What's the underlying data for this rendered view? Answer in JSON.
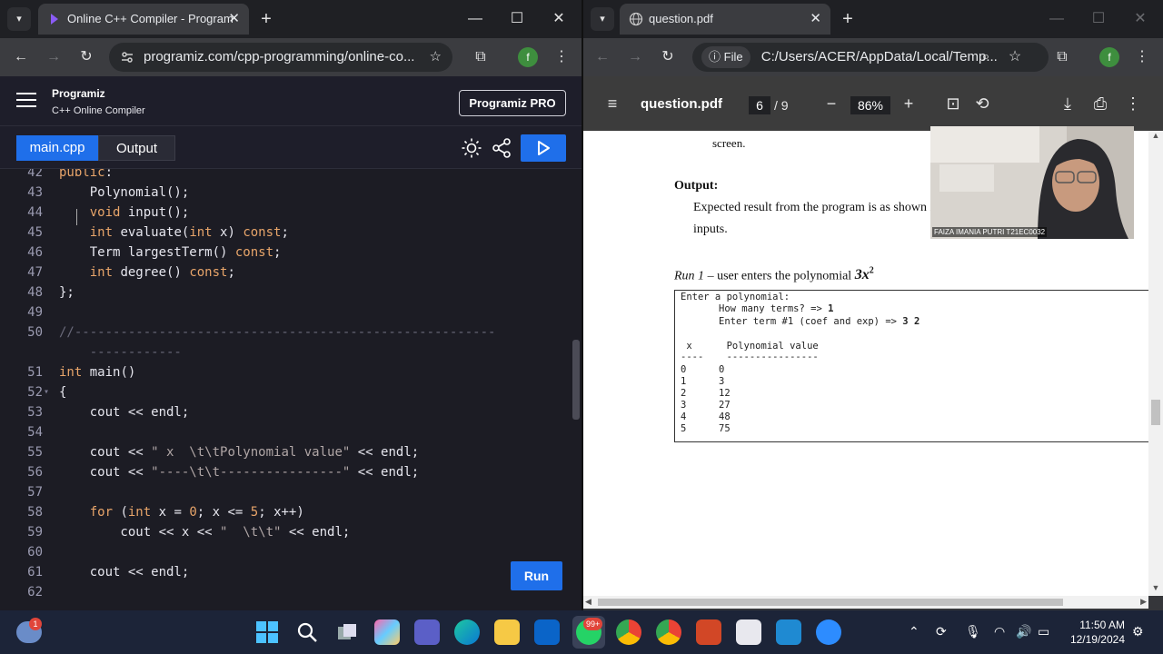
{
  "left_browser": {
    "tab_title": "Online C++ Compiler - Program",
    "url": "programiz.com/cpp-programming/online-co...",
    "profile_initial": "f"
  },
  "right_browser": {
    "tab_title": "question.pdf",
    "url_scheme": "File",
    "url": "C:/Users/ACER/AppData/Local/Temp...",
    "profile_initial": "f"
  },
  "programiz": {
    "logo": "Programiz",
    "title": "C++ Online Compiler",
    "pro_button": "Programiz PRO",
    "file_tab": "main.cpp",
    "output_tab": "Output",
    "run_button": "Run"
  },
  "code": [
    {
      "n": "42",
      "fold": "",
      "segs": [
        [
          "kw",
          "public"
        ],
        [
          "t",
          ":"
        ]
      ]
    },
    {
      "n": "43",
      "fold": "",
      "segs": [
        [
          "t",
          "    Polynomial();"
        ]
      ]
    },
    {
      "n": "44",
      "fold": "",
      "segs": [
        [
          "t",
          "    "
        ],
        [
          "kw",
          "void"
        ],
        [
          "t",
          " input();"
        ]
      ]
    },
    {
      "n": "45",
      "fold": "",
      "segs": [
        [
          "t",
          "    "
        ],
        [
          "kw",
          "int"
        ],
        [
          "t",
          " evaluate("
        ],
        [
          "kw",
          "int"
        ],
        [
          "t",
          " x) "
        ],
        [
          "kw",
          "const"
        ],
        [
          "t",
          ";"
        ]
      ]
    },
    {
      "n": "46",
      "fold": "",
      "segs": [
        [
          "t",
          "    Term largestTerm() "
        ],
        [
          "kw",
          "const"
        ],
        [
          "t",
          ";"
        ]
      ]
    },
    {
      "n": "47",
      "fold": "",
      "segs": [
        [
          "t",
          "    "
        ],
        [
          "kw",
          "int"
        ],
        [
          "t",
          " degree() "
        ],
        [
          "kw",
          "const"
        ],
        [
          "t",
          ";"
        ]
      ]
    },
    {
      "n": "48",
      "fold": "",
      "segs": [
        [
          "t",
          "};"
        ]
      ]
    },
    {
      "n": "49",
      "fold": "",
      "segs": []
    },
    {
      "n": "50",
      "fold": "",
      "segs": [
        [
          "cm",
          "//-------------------------------------------------------"
        ]
      ]
    },
    {
      "n": "",
      "fold": "",
      "segs": [
        [
          "cm",
          "    ------------"
        ]
      ]
    },
    {
      "n": "51",
      "fold": "",
      "segs": [
        [
          "kw",
          "int"
        ],
        [
          "t",
          " main()"
        ]
      ]
    },
    {
      "n": "52",
      "fold": "▾",
      "segs": [
        [
          "t",
          "{"
        ]
      ]
    },
    {
      "n": "53",
      "fold": "",
      "segs": [
        [
          "t",
          "    cout << endl;"
        ]
      ]
    },
    {
      "n": "54",
      "fold": "",
      "segs": []
    },
    {
      "n": "55",
      "fold": "",
      "segs": [
        [
          "t",
          "    cout << "
        ],
        [
          "str",
          "\" x  \\t\\tPolynomial value\""
        ],
        [
          "t",
          " << endl;"
        ]
      ]
    },
    {
      "n": "56",
      "fold": "",
      "segs": [
        [
          "t",
          "    cout << "
        ],
        [
          "str",
          "\"----\\t\\t----------------\""
        ],
        [
          "t",
          " << endl;"
        ]
      ]
    },
    {
      "n": "57",
      "fold": "",
      "segs": []
    },
    {
      "n": "58",
      "fold": "",
      "segs": [
        [
          "t",
          "    "
        ],
        [
          "kw",
          "for"
        ],
        [
          "t",
          " ("
        ],
        [
          "kw",
          "int"
        ],
        [
          "t",
          " x = "
        ],
        [
          "num",
          "0"
        ],
        [
          "t",
          "; x <= "
        ],
        [
          "num",
          "5"
        ],
        [
          "t",
          "; x++)"
        ]
      ]
    },
    {
      "n": "59",
      "fold": "",
      "segs": [
        [
          "t",
          "        cout << x << "
        ],
        [
          "str",
          "\"  \\t\\t\""
        ],
        [
          "t",
          " << endl;"
        ]
      ]
    },
    {
      "n": "60",
      "fold": "",
      "segs": []
    },
    {
      "n": "61",
      "fold": "",
      "segs": [
        [
          "t",
          "    cout << endl;"
        ]
      ]
    },
    {
      "n": "62",
      "fold": "",
      "segs": []
    }
  ],
  "pdf": {
    "title": "question.pdf",
    "page": "6",
    "page_total": "/  9",
    "zoom": "86%",
    "screen_word": "screen.",
    "output_heading": "Output:",
    "expected_line1": "Expected result from the program is as shown i",
    "expected_line2": "inputs.",
    "run_label": "Run 1",
    "run_text": " – user enters the polynomial ",
    "run_poly": "3x",
    "run_sup": "2",
    "console": {
      "l1": "Enter a polynomial:",
      "l2": "How many terms? => ",
      "l2b": "1",
      "l3": "Enter term #1 (coef and exp) => ",
      "l3b": "3 2",
      "h1": " x      Polynomial value",
      "h2": "----    ----------------",
      "rows": [
        [
          "0",
          "0"
        ],
        [
          "1",
          "3"
        ],
        [
          "2",
          "12"
        ],
        [
          "3",
          "27"
        ],
        [
          "4",
          "48"
        ],
        [
          "5",
          "75"
        ]
      ]
    },
    "webcam_caption": "FAIZA IMANIA PUTRI T21EC0032"
  },
  "taskbar": {
    "notif_badge": "1",
    "whatsapp_badge": "99+",
    "time": "11:50 AM",
    "date": "12/19/2024"
  }
}
